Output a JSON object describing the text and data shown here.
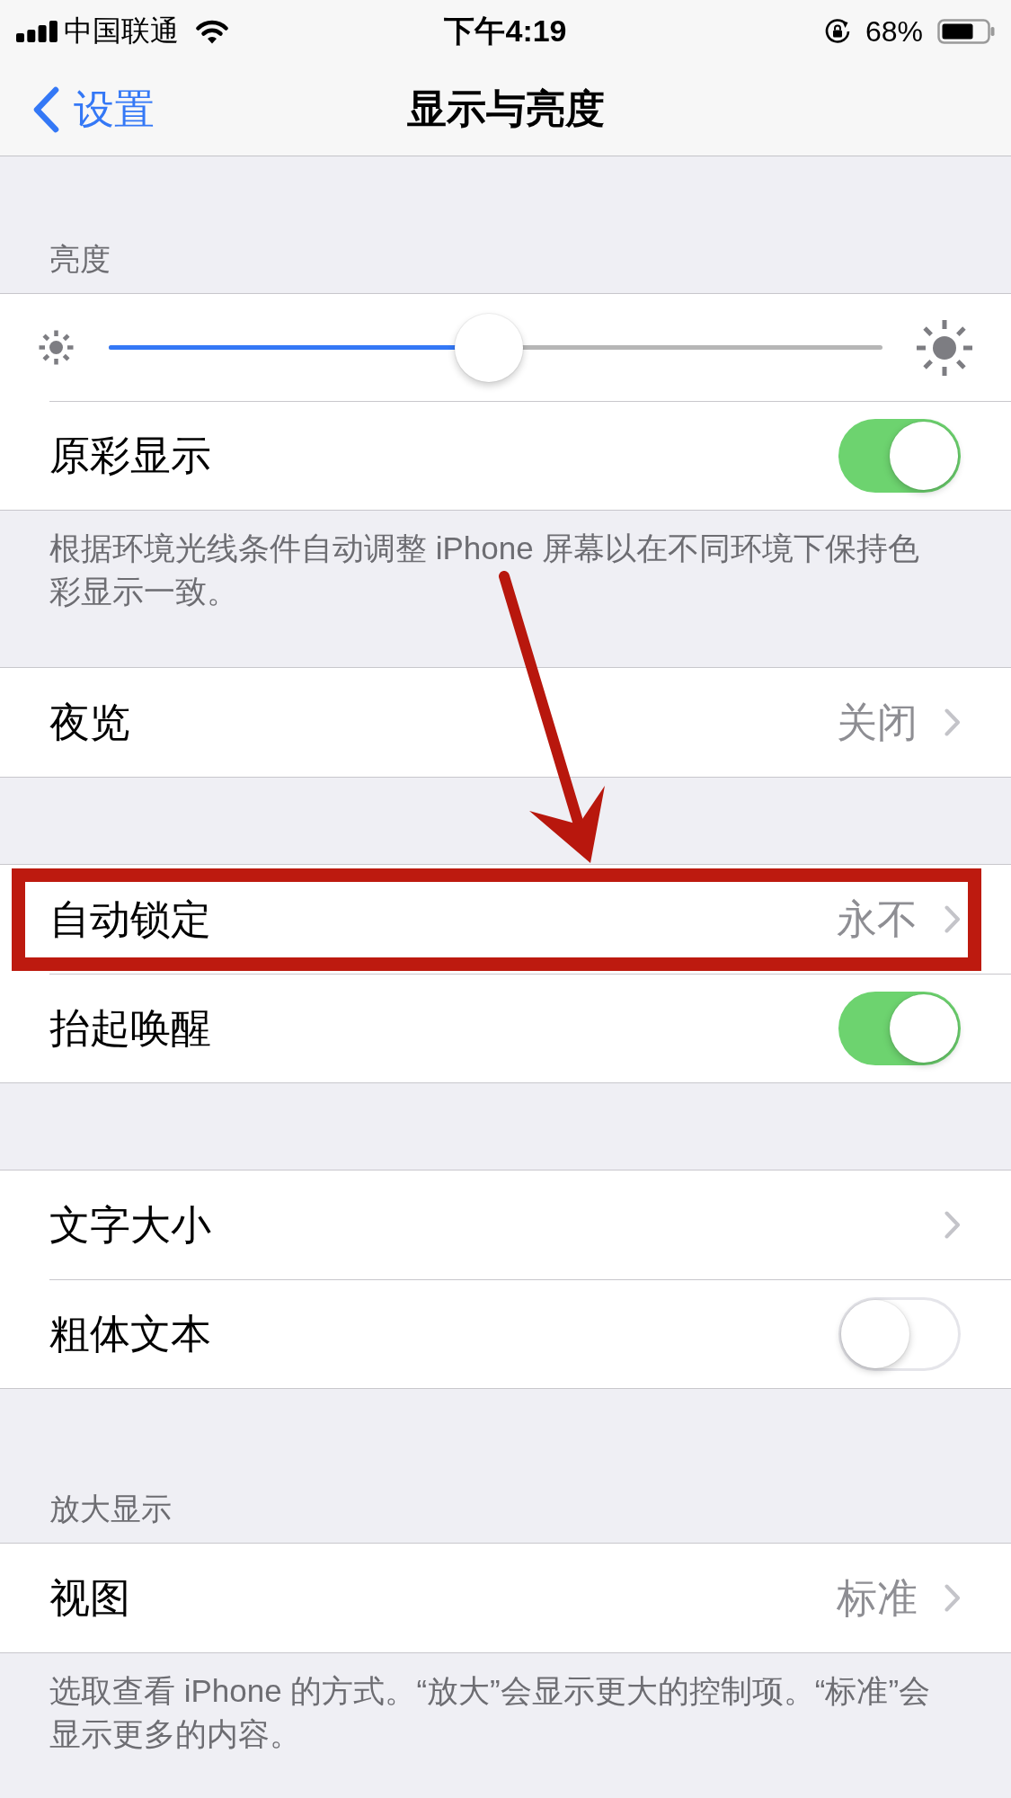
{
  "status_bar": {
    "carrier": "中国联通",
    "time": "下午4:19",
    "battery_percent": "68%"
  },
  "nav_bar": {
    "back_label": "设置",
    "title": "显示与亮度"
  },
  "sections": [
    {
      "header": "亮度",
      "rows": [
        {
          "kind": "slider",
          "level": 0.49,
          "highlighted": false
        },
        {
          "kind": "switch",
          "label": "原彩显示",
          "on": true,
          "highlighted": false
        }
      ],
      "footer": "根据环境光线条件自动调整 iPhone 屏幕以在不同环境下保持色彩显示一致。"
    },
    {
      "rows": [
        {
          "kind": "disclosure",
          "label": "夜览",
          "value": "关闭",
          "highlighted": false
        }
      ]
    },
    {
      "rows": [
        {
          "kind": "disclosure",
          "label": "自动锁定",
          "value": "永不",
          "highlighted": true
        },
        {
          "kind": "switch",
          "label": "抬起唤醒",
          "on": true,
          "highlighted": false
        }
      ]
    },
    {
      "rows": [
        {
          "kind": "disclosure",
          "label": "文字大小",
          "highlighted": false
        },
        {
          "kind": "switch",
          "label": "粗体文本",
          "on": false,
          "highlighted": false
        }
      ]
    },
    {
      "header": "放大显示",
      "rows": [
        {
          "kind": "disclosure",
          "label": "视图",
          "value": "标准",
          "highlighted": false
        }
      ],
      "footer": "选取查看 iPhone 的方式。“放大”会显示更大的控制项。“标准”会显示更多的内容。"
    }
  ]
}
